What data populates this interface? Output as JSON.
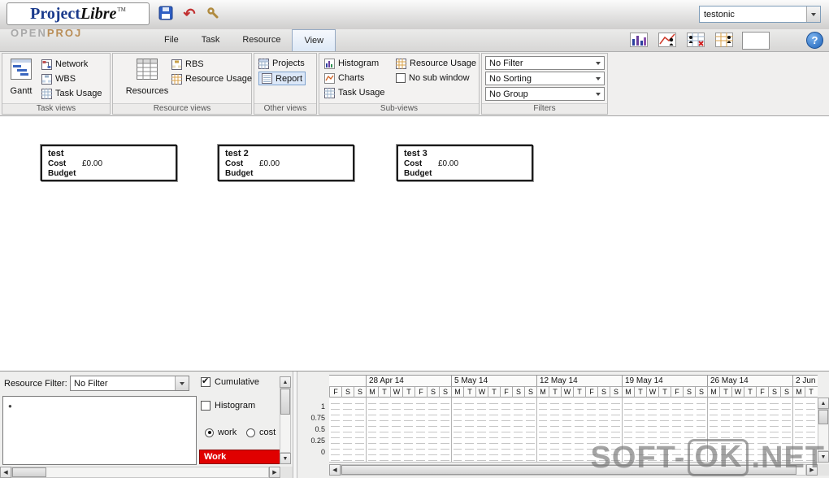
{
  "titlebar": {
    "logo": {
      "project": "Project",
      "libre": "Libre",
      "tm": "TM"
    },
    "brand_sub_open": "OPEN",
    "brand_sub_proj": "PROJ",
    "project_selector_value": "testonic"
  },
  "tabs": {
    "items": [
      {
        "label": "File"
      },
      {
        "label": "Task"
      },
      {
        "label": "Resource"
      },
      {
        "label": "View"
      }
    ],
    "active": "View"
  },
  "ribbon": {
    "task_views": {
      "title": "Task views",
      "gantt": "Gantt",
      "network": "Network",
      "wbs": "WBS",
      "task_usage": "Task Usage"
    },
    "resource_views": {
      "title": "Resource views",
      "resources": "Resources",
      "rbs": "RBS",
      "resource_usage": "Resource Usage"
    },
    "other_views": {
      "title": "Other views",
      "projects": "Projects",
      "report": "Report"
    },
    "sub_views": {
      "title": "Sub-views",
      "histogram": "Histogram",
      "charts": "Charts",
      "task_usage": "Task Usage",
      "resource_usage": "Resource Usage",
      "no_sub_window": "No sub window"
    },
    "filters": {
      "title": "Filters",
      "filter_value": "No Filter",
      "sorting_value": "No Sorting",
      "group_value": "No Group"
    }
  },
  "cards": [
    {
      "title": "test",
      "cost_label": "Cost",
      "cost_value": "£0.00",
      "budget_label": "Budget"
    },
    {
      "title": "test 2",
      "cost_label": "Cost",
      "cost_value": "£0.00",
      "budget_label": "Budget"
    },
    {
      "title": "test 3",
      "cost_label": "Cost",
      "cost_value": "£0.00",
      "budget_label": "Budget"
    }
  ],
  "bottom": {
    "resource_filter_label": "Resource Filter:",
    "resource_filter_value": "No Filter",
    "cumulative_label": "Cumulative",
    "histogram_label": "Histogram",
    "work_radio_label": "work",
    "cost_radio_label": "cost",
    "work_bar_label": "Work",
    "timeline": {
      "y_ticks": [
        "1",
        "0.75",
        "0.5",
        "0.25",
        "0"
      ],
      "weeks": [
        {
          "label": "28 Apr 14",
          "start_index": 3
        },
        {
          "label": "5 May 14",
          "start_index": 10
        },
        {
          "label": "12 May 14",
          "start_index": 17
        },
        {
          "label": "19 May 14",
          "start_index": 24
        },
        {
          "label": "26 May 14",
          "start_index": 31
        },
        {
          "label": "2 Jun",
          "start_index": 38
        }
      ],
      "day_letters": [
        "F",
        "S",
        "S",
        "M",
        "T",
        "W",
        "T",
        "F",
        "S",
        "S",
        "M",
        "T",
        "W",
        "T",
        "F",
        "S",
        "S",
        "M",
        "T",
        "W",
        "T",
        "F",
        "S",
        "S",
        "M",
        "T",
        "W",
        "T",
        "F",
        "S",
        "S",
        "M",
        "T",
        "W",
        "T",
        "F",
        "S",
        "S",
        "M",
        "T"
      ]
    }
  },
  "icons": {
    "up_arrow": "▲",
    "down_arrow": "▼",
    "left_arrow": "◀",
    "right_arrow": "▶",
    "undo": "↶",
    "help": "?",
    "bullet": "●"
  },
  "watermark": {
    "pre": "SOFT-",
    "ok": "OK",
    "post": ".NET"
  },
  "colors": {
    "accent_blue": "#1a3a8c",
    "selected_blue": "#dce8f8",
    "work_red": "#e00000"
  }
}
